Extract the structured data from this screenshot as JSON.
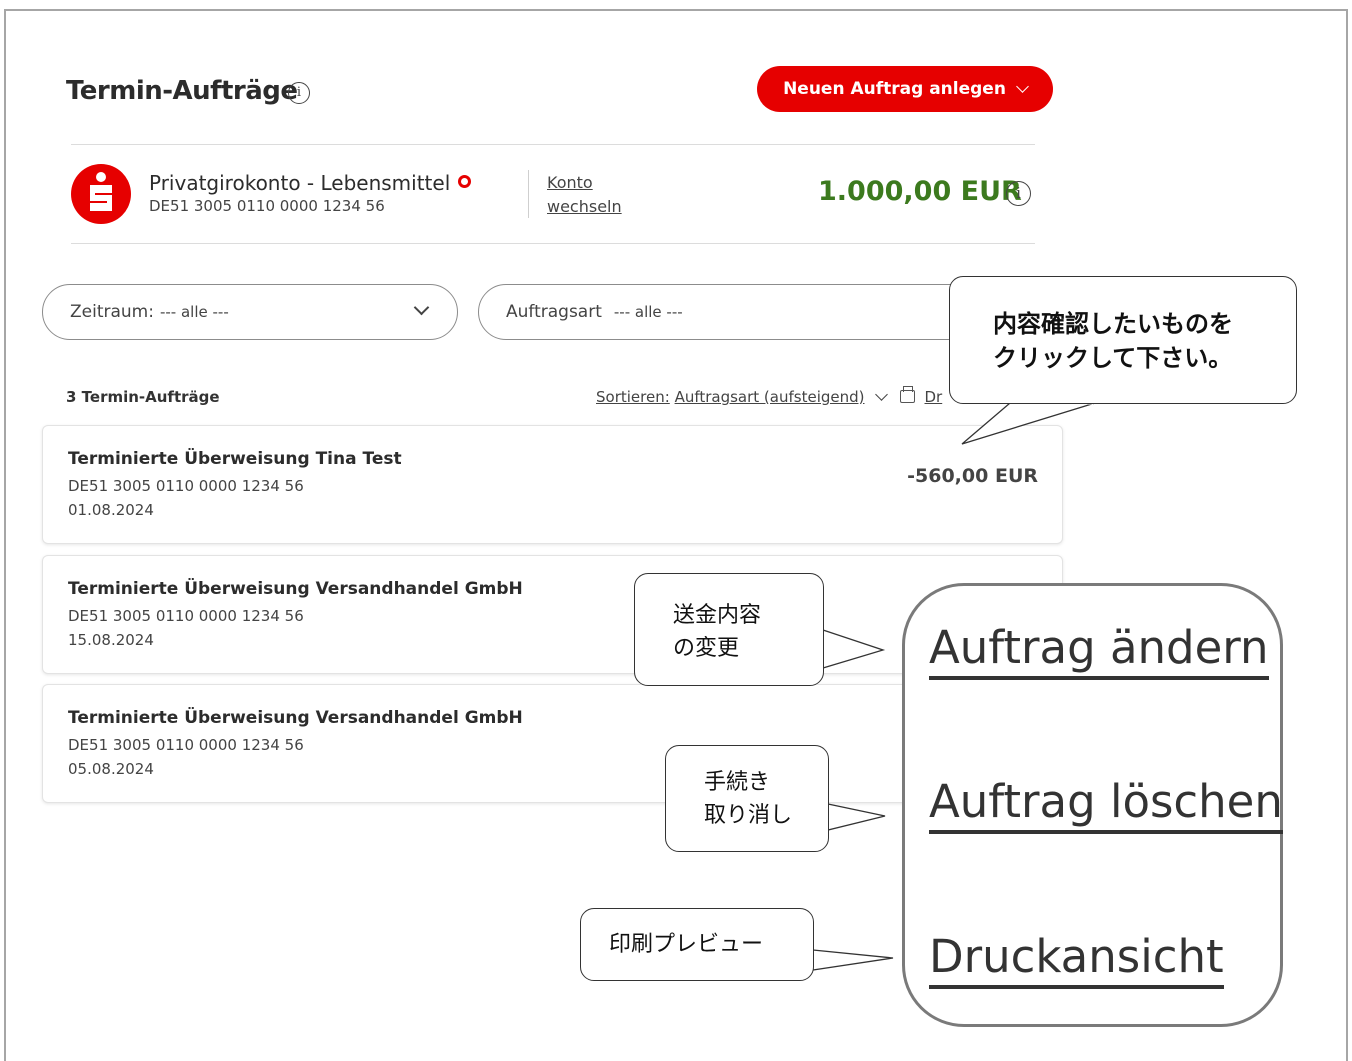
{
  "page": {
    "title": "Termin-Aufträge"
  },
  "header": {
    "new_order_label": "Neuen Auftrag anlegen"
  },
  "account": {
    "name": "Privatgirokonto - Lebensmittel",
    "iban": "DE51 3005 0110 0000 1234 56",
    "switch_label_1": "Konto",
    "switch_label_2": "wechseln",
    "balance": "1.000,00 EUR",
    "balance_color": "#3c7a1e"
  },
  "filters": {
    "zeitraum_label": "Zeitraum:",
    "zeitraum_value": "--- alle ---",
    "auftragsart_label": "Auftragsart",
    "auftragsart_value": "--- alle ---"
  },
  "list": {
    "count_label": "3 Termin-Aufträge",
    "sort_prefix": "Sortieren:",
    "sort_value": "Auftragsart (aufsteigend)",
    "print_label": "Dr",
    "items": [
      {
        "title": "Terminierte Überweisung Tina Test",
        "iban": "DE51 3005 0110 0000 1234 56",
        "date": "01.08.2024",
        "amount": "-560,00 EUR"
      },
      {
        "title": "Terminierte Überweisung Versandhandel GmbH",
        "iban": "DE51 3005 0110 0000 1234 56",
        "date": "15.08.2024"
      },
      {
        "title": "Terminierte Überweisung Versandhandel GmbH",
        "iban": "DE51 3005 0110 0000 1234 56",
        "date": "05.08.2024"
      }
    ]
  },
  "callouts": {
    "top_line1": "内容確認したいものを",
    "top_line2": "クリックして下さい。",
    "change_line1": "送金内容",
    "change_line2": "の変更",
    "cancel_line1": "手続き",
    "cancel_line2": "取り消し",
    "preview": "印刷プレビュー"
  },
  "zoom_menu": {
    "edit": "Auftrag ändern",
    "delete": "Auftrag löschen",
    "print": "Druckansicht"
  },
  "colors": {
    "brand_red": "#e60000"
  },
  "icons": {
    "title_info": "info-icon",
    "balance_info": "info-icon",
    "dropdown": "chevron-down-icon",
    "print": "printer-icon",
    "logo": "sparkasse-logo"
  }
}
